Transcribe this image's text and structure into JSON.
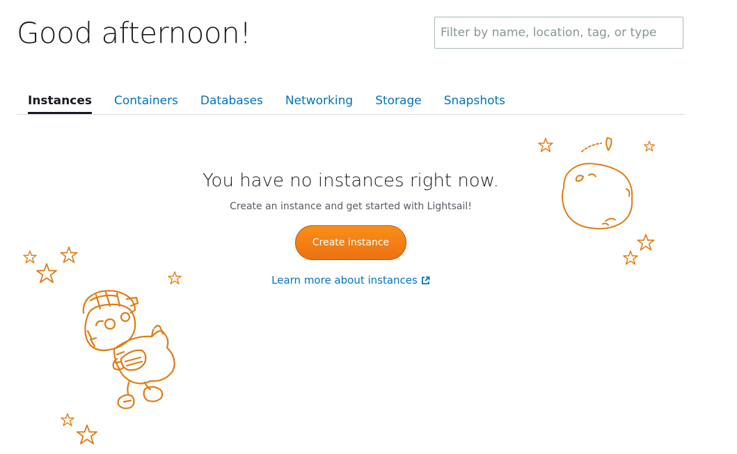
{
  "header": {
    "greeting": "Good afternoon!",
    "filter_placeholder": "Filter by name, location, tag, or type",
    "filter_value": ""
  },
  "tabs": [
    {
      "label": "Instances",
      "active": true
    },
    {
      "label": "Containers",
      "active": false
    },
    {
      "label": "Databases",
      "active": false
    },
    {
      "label": "Networking",
      "active": false
    },
    {
      "label": "Storage",
      "active": false
    },
    {
      "label": "Snapshots",
      "active": false
    }
  ],
  "empty_state": {
    "title": "You have no instances right now.",
    "subtitle": "Create an instance and get started with Lightsail!",
    "create_button": "Create instance",
    "learn_more": "Learn more about instances"
  },
  "icons": {
    "external_link": "external-link-icon",
    "illustration_robot": "robot-astronaut-illustration",
    "illustration_moon": "moon-illustration",
    "stars": "star-icon"
  },
  "colors": {
    "accent_orange": "#ec7211",
    "link_blue": "#0073bb",
    "text_dark": "#16191f",
    "illustration_orange": "#e07b13"
  }
}
